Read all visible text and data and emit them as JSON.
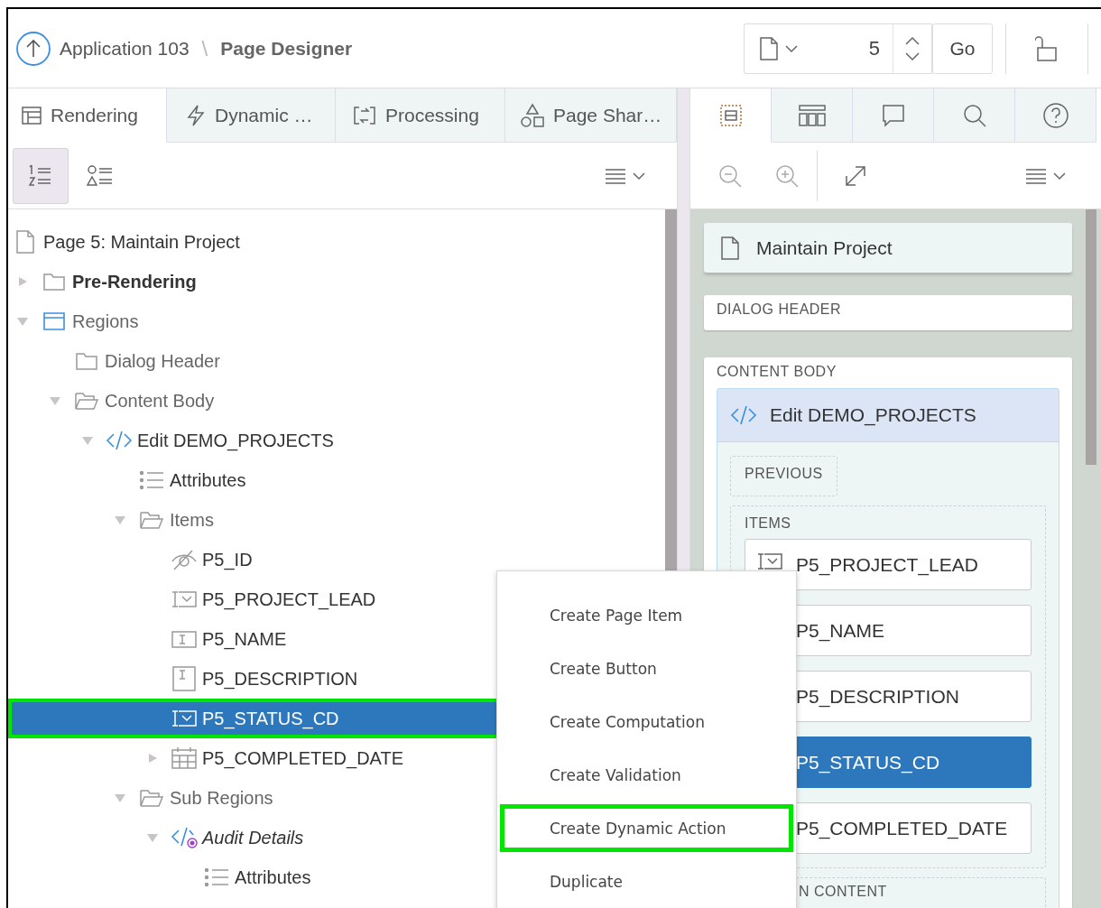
{
  "header": {
    "app_link": "Application 103",
    "separator": "\\",
    "page_title": "Page Designer",
    "page_number": "5",
    "go_button": "Go"
  },
  "left_tabs": [
    {
      "label": "Rendering",
      "selected": true
    },
    {
      "label": "Dynamic …",
      "selected": false
    },
    {
      "label": "Processing",
      "selected": false
    },
    {
      "label": "Page Shar…",
      "selected": false
    }
  ],
  "view_buttons": [
    {
      "selected": true
    },
    {
      "selected": false
    }
  ],
  "right_tabs": [
    {
      "selected": true
    },
    {
      "selected": false
    },
    {
      "selected": false
    },
    {
      "selected": false
    },
    {
      "selected": false
    }
  ],
  "tree": [
    {
      "label": "Page 5: Maintain Project",
      "kind": "page",
      "selected": false,
      "highlighted": false,
      "children": [
        {
          "label": "Pre-Rendering",
          "kind": "section",
          "expanded": false,
          "selected": false,
          "highlighted": false
        },
        {
          "label": "Regions",
          "kind": "region",
          "expanded": true,
          "selected": false,
          "highlighted": false,
          "children": [
            {
              "label": "Dialog Header",
              "kind": "folder",
              "selected": false,
              "highlighted": false
            },
            {
              "label": "Content Body",
              "kind": "openfolder",
              "expanded": true,
              "selected": false,
              "highlighted": false,
              "children": [
                {
                  "label": "Edit DEMO_PROJECTS",
                  "kind": "code",
                  "expanded": true,
                  "selected": false,
                  "highlighted": false,
                  "children": [
                    {
                      "label": "Attributes",
                      "kind": "attributes",
                      "selected": false,
                      "highlighted": false
                    },
                    {
                      "label": "Items",
                      "kind": "openfolder",
                      "expanded": true,
                      "selected": false,
                      "highlighted": false,
                      "children": [
                        {
                          "label": "P5_ID",
                          "kind": "hidden",
                          "selected": false,
                          "highlighted": false
                        },
                        {
                          "label": "P5_PROJECT_LEAD",
                          "kind": "selectlist",
                          "selected": false,
                          "highlighted": false
                        },
                        {
                          "label": "P5_NAME",
                          "kind": "textfield",
                          "selected": false,
                          "highlighted": false
                        },
                        {
                          "label": "P5_DESCRIPTION",
                          "kind": "textarea",
                          "selected": false,
                          "highlighted": false
                        },
                        {
                          "label": "P5_STATUS_CD",
                          "kind": "selectlist",
                          "selected": true,
                          "highlighted": true
                        },
                        {
                          "label": "P5_COMPLETED_DATE",
                          "kind": "date",
                          "expanded": false,
                          "selected": false,
                          "highlighted": false
                        }
                      ]
                    },
                    {
                      "label": "Sub Regions",
                      "kind": "openfolder",
                      "expanded": true,
                      "selected": false,
                      "highlighted": false,
                      "children": [
                        {
                          "label": "Audit Details",
                          "kind": "plugin",
                          "expanded": true,
                          "selected": false,
                          "highlighted": false,
                          "children": [
                            {
                              "label": "Attributes",
                              "kind": "attributes",
                              "selected": false,
                              "highlighted": false
                            }
                          ]
                        }
                      ]
                    }
                  ]
                }
              ]
            }
          ]
        }
      ]
    }
  ],
  "canvas": {
    "page_title": "Maintain Project",
    "regions": [
      {
        "label": "DIALOG HEADER"
      },
      {
        "label": "CONTENT BODY",
        "region": {
          "title": "Edit DEMO_PROJECTS",
          "slots": [
            {
              "label": "PREVIOUS"
            },
            {
              "label": "ITEMS",
              "items": [
                {
                  "label": "P5_PROJECT_LEAD",
                  "kind": "selectlist",
                  "selected": false
                },
                {
                  "label": "P5_NAME",
                  "selected": false
                },
                {
                  "label": "P5_DESCRIPTION",
                  "selected": false
                },
                {
                  "label": "P5_STATUS_CD",
                  "selected": true
                },
                {
                  "label": "P5_COMPLETED_DATE",
                  "selected": false
                }
              ]
            },
            {
              "label": "N CONTENT"
            }
          ]
        }
      }
    ]
  },
  "context_menu": [
    {
      "label": "Create Page Item",
      "highlighted": false
    },
    {
      "label": "Create Button",
      "highlighted": false
    },
    {
      "label": "Create Computation",
      "highlighted": false
    },
    {
      "label": "Create Validation",
      "highlighted": false
    },
    {
      "label": "Create Dynamic Action",
      "highlighted": true
    },
    {
      "label": "Duplicate",
      "highlighted": false
    }
  ]
}
